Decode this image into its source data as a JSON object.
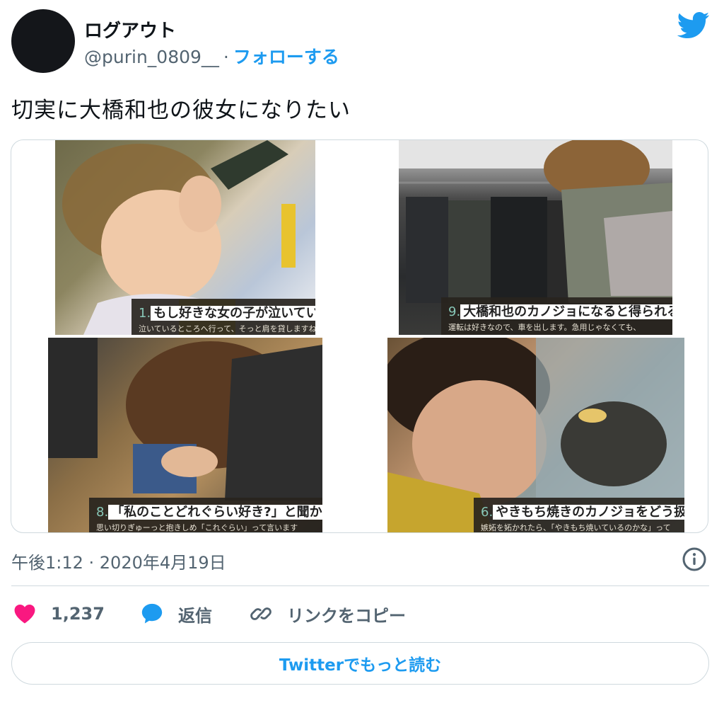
{
  "account": {
    "display_name": "ログアウト",
    "handle": "@purin_0809__",
    "separator": "·",
    "follow_label": "フォローする"
  },
  "tweet": {
    "text": "切実に大橋和也の彼女になりたい",
    "timestamp": "午後1:12 · 2020年4月19日"
  },
  "media": {
    "photos": [
      {
        "number": "1.",
        "question": "もし好きな女の子が泣いていたら?",
        "subtext": "泣いているところへ行って、そっと肩を貸しますね。そ"
      },
      {
        "number": "9.",
        "question": "大橋和也のカノジョになると得られる特権は?",
        "subtext": "運転は好きなので、車を出します。急用じゃなくても、"
      },
      {
        "number": "8.",
        "question": "「私のことどれぐらい好き?」と聞かれたら?",
        "subtext": "思い切りぎゅーっと抱きしめ「これぐらい」って言います"
      },
      {
        "number": "6.",
        "question": "やきもち焼きのカノジョをどう扱う?",
        "subtext": "嫉妬を妬かれたら、「やきもち焼いているのかな」って"
      }
    ]
  },
  "actions": {
    "like_count": "1,237",
    "reply_label": "返信",
    "copy_link_label": "リンクをコピー"
  },
  "read_more_label": "Twitterでもっと読む",
  "colors": {
    "accent": "#1d9bf0",
    "like": "#f91880",
    "text": "#0f1419",
    "secondary": "#536471",
    "border": "#cfd9de"
  },
  "icons": {
    "brand": "twitter-bird-icon",
    "like": "heart-icon",
    "reply": "speech-bubble-icon",
    "copy_link": "link-icon",
    "info": "info-icon"
  }
}
